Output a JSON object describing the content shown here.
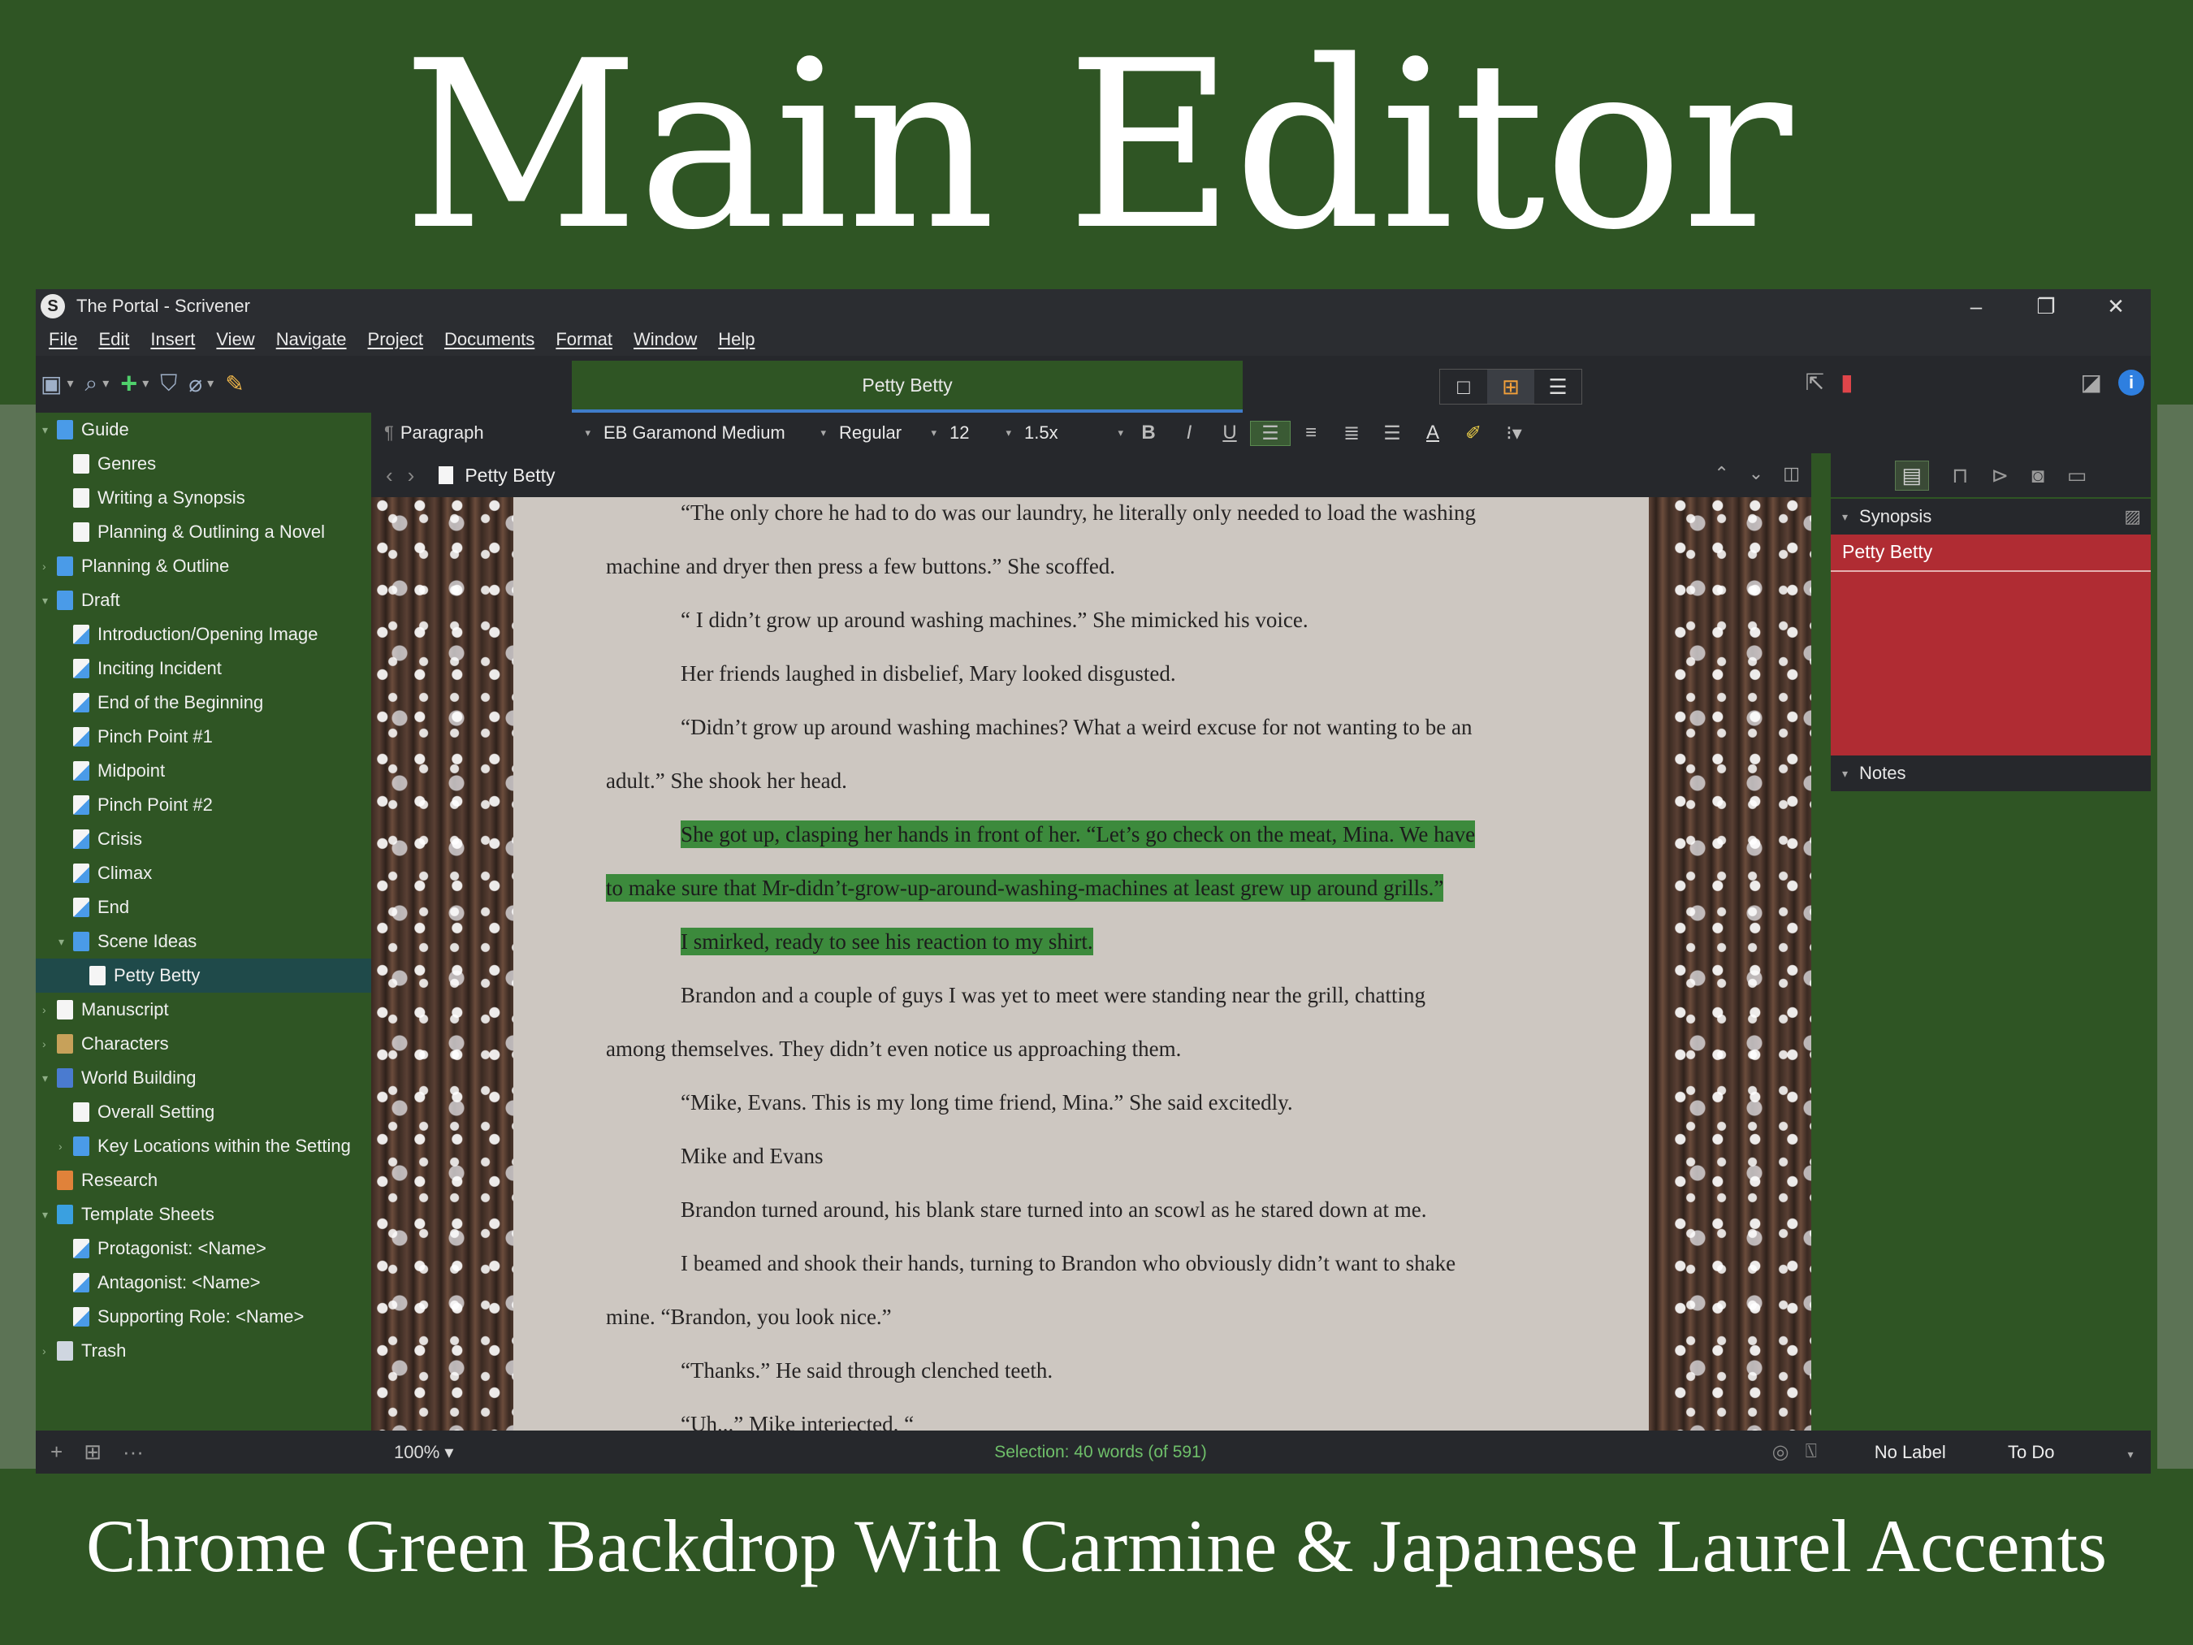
{
  "hero": {
    "title": "Main Editor",
    "subtitle": "Chrome Green Backdrop With Carmine & Japanese Laurel Accents"
  },
  "window": {
    "title": "The Portal - Scrivener",
    "controls": [
      "–",
      "❐",
      "✕"
    ]
  },
  "menu": [
    "File",
    "Edit",
    "Insert",
    "View",
    "Navigate",
    "Project",
    "Documents",
    "Format",
    "Window",
    "Help"
  ],
  "toolbar": {
    "document_title": "Petty Betty",
    "view_modes": [
      "□",
      "⊞",
      "☰"
    ]
  },
  "binder": {
    "items": [
      {
        "label": "Guide",
        "icon": "folder",
        "depth": 0,
        "arrow": "▾"
      },
      {
        "label": "Genres",
        "icon": "text",
        "depth": 1
      },
      {
        "label": "Writing a Synopsis",
        "icon": "text",
        "depth": 1
      },
      {
        "label": "Planning & Outlining a Novel",
        "icon": "text",
        "depth": 1
      },
      {
        "label": "Planning & Outline",
        "icon": "folder",
        "depth": 0,
        "arrow": "›"
      },
      {
        "label": "Draft",
        "icon": "folder",
        "depth": 0,
        "arrow": "▾"
      },
      {
        "label": "Introduction/Opening Image",
        "icon": "scene",
        "depth": 1
      },
      {
        "label": "Inciting Incident",
        "icon": "scene",
        "depth": 1
      },
      {
        "label": "End of the Beginning",
        "icon": "scene",
        "depth": 1
      },
      {
        "label": "Pinch Point #1",
        "icon": "scene",
        "depth": 1
      },
      {
        "label": "Midpoint",
        "icon": "scene",
        "depth": 1
      },
      {
        "label": "Pinch Point #2",
        "icon": "scene",
        "depth": 1
      },
      {
        "label": "Crisis",
        "icon": "scene",
        "depth": 1
      },
      {
        "label": "Climax",
        "icon": "scene",
        "depth": 1
      },
      {
        "label": "End",
        "icon": "scene",
        "depth": 1
      },
      {
        "label": "Scene Ideas",
        "icon": "folder",
        "depth": 1,
        "arrow": "▾"
      },
      {
        "label": "Petty Betty",
        "icon": "text",
        "depth": 2,
        "selected": true
      },
      {
        "label": "Manuscript",
        "icon": "text",
        "depth": 0,
        "arrow": "›"
      },
      {
        "label": "Characters",
        "icon": "char",
        "depth": 0,
        "arrow": "›"
      },
      {
        "label": "World Building",
        "icon": "world",
        "depth": 0,
        "arrow": "▾"
      },
      {
        "label": "Overall Setting",
        "icon": "text",
        "depth": 1
      },
      {
        "label": "Key Locations within the Setting",
        "icon": "folder",
        "depth": 1,
        "arrow": "›"
      },
      {
        "label": "Research",
        "icon": "research",
        "depth": 0
      },
      {
        "label": "Template Sheets",
        "icon": "template",
        "depth": 0,
        "arrow": "▾"
      },
      {
        "label": "Protagonist: <Name>",
        "icon": "scene",
        "depth": 1
      },
      {
        "label": "Antagonist: <Name>",
        "icon": "scene",
        "depth": 1
      },
      {
        "label": "Supporting Role: <Name>",
        "icon": "scene",
        "depth": 1
      },
      {
        "label": "Trash",
        "icon": "trash",
        "depth": 0,
        "arrow": "›"
      }
    ],
    "footer_icons": [
      "+",
      "⊞",
      "···"
    ]
  },
  "format_bar": {
    "style": "Paragraph",
    "font": "EB Garamond Medium",
    "weight": "Regular",
    "size": "12",
    "line_spacing": "1.5x",
    "bold": "B",
    "italic": "I",
    "underline": "U"
  },
  "editor": {
    "header_title": "Petty Betty",
    "paragraphs": [
      {
        "text": "“The only chore he had to do was our laundry, he literally only needed to load the washing",
        "indent": true,
        "hl": false
      },
      {
        "text": "machine and dryer then press a few buttons.” She scoffed.",
        "indent": false,
        "hl": false
      },
      {
        "text": "“ I didn’t grow up around washing machines.” She mimicked his voice.",
        "indent": true,
        "hl": false
      },
      {
        "text": "Her friends laughed in disbelief, Mary looked disgusted.",
        "indent": true,
        "hl": false
      },
      {
        "text": "“Didn’t grow up around washing machines? What a weird excuse for not wanting to be an",
        "indent": true,
        "hl": false
      },
      {
        "text": "adult.” She shook her head.",
        "indent": false,
        "hl": false
      },
      {
        "text": "She got up, clasping her hands in front of her. “Let’s go check on the meat, Mina. We have",
        "indent": true,
        "hl": true
      },
      {
        "text": "to make sure that Mr-didn’t-grow-up-around-washing-machines at least grew up around grills.”",
        "indent": false,
        "hl": true
      },
      {
        "text": "I smirked, ready to see his reaction to my shirt.",
        "indent": true,
        "hl": true
      },
      {
        "text": "Brandon and a couple of guys I was yet to meet were standing near the grill, chatting",
        "indent": true,
        "hl": false
      },
      {
        "text": "among themselves. They didn’t even notice us approaching them.",
        "indent": false,
        "hl": false
      },
      {
        "text": "“Mike, Evans. This is my long time friend, Mina.” She said excitedly.",
        "indent": true,
        "hl": false
      },
      {
        "text": "Mike and Evans",
        "indent": true,
        "hl": false
      },
      {
        "text": "Brandon turned around, his blank stare turned into an scowl as he stared down at me.",
        "indent": true,
        "hl": false
      },
      {
        "text": "I beamed and shook their hands, turning to Brandon who obviously didn’t want to shake",
        "indent": true,
        "hl": false
      },
      {
        "text": "mine. “Brandon, you look nice.”",
        "indent": false,
        "hl": false
      },
      {
        "text": "“Thanks.” He said through clenched teeth.",
        "indent": true,
        "hl": false
      },
      {
        "text": "“Uh...” Mike interjected. “",
        "indent": true,
        "hl": false
      }
    ]
  },
  "status": {
    "zoom": "100%",
    "selection": "Selection: 40 words (of 591)"
  },
  "inspector": {
    "synopsis_label": "Synopsis",
    "synopsis_title": "Petty Betty",
    "notes_label": "Notes",
    "label_value": "No Label",
    "status_value": "To Do"
  },
  "colors": {
    "chrome_green": "#2f5524",
    "carmine": "#b02c33",
    "japanese_laurel": "#3c8a3c"
  }
}
